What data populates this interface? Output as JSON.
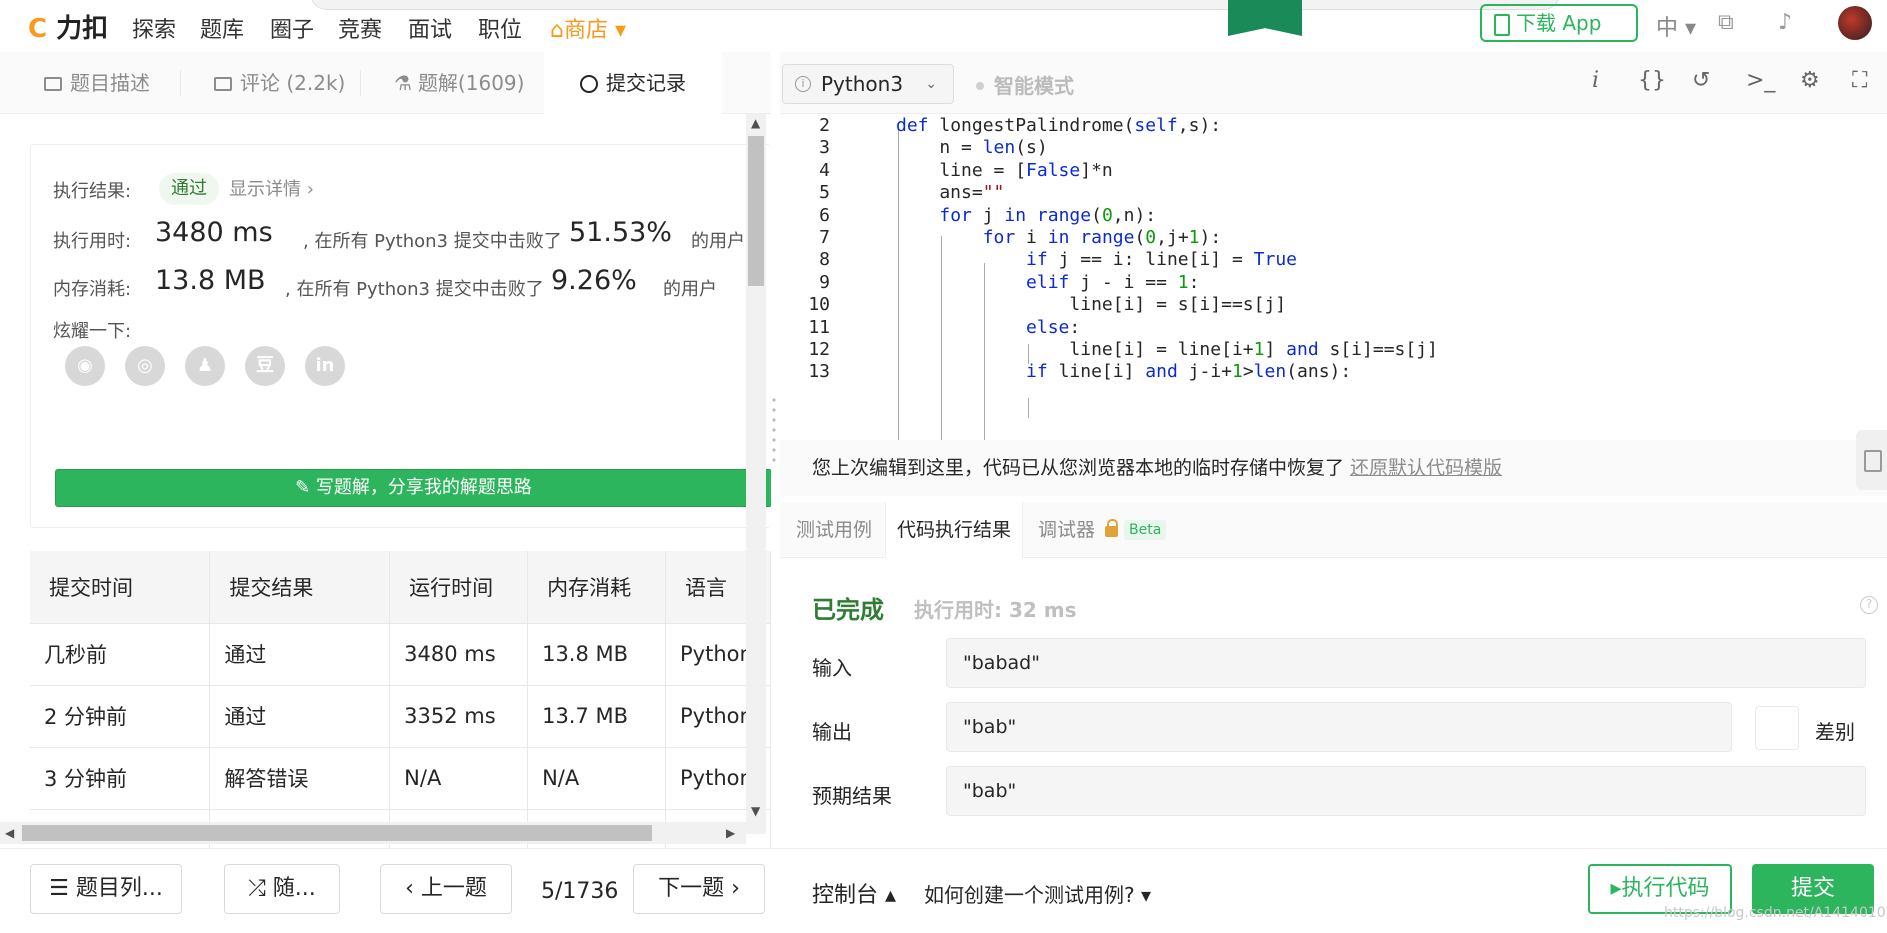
{
  "topnav": {
    "logo": "力扣",
    "items": [
      "探索",
      "题库",
      "圈子",
      "竞赛",
      "面试",
      "职位"
    ],
    "shop": "商店",
    "download_app": "下载 App",
    "lang": "中"
  },
  "left_tabs": [
    {
      "label": "题目描述"
    },
    {
      "label": "评论 (2.2k)"
    },
    {
      "label": "题解(1609)"
    },
    {
      "label": "提交记录"
    }
  ],
  "result": {
    "exec_result_label": "执行结果:",
    "status": "通过",
    "details_link": "显示详情 ›",
    "time_label": "执行用时:",
    "time_value": "3480 ms",
    "time_mid": ", 在所有 Python3 提交中击败了",
    "time_pct": "51.53%",
    "mem_label": "内存消耗:",
    "mem_value": "13.8 MB",
    "mem_mid": ", 在所有 Python3 提交中击败了",
    "mem_pct": "9.26%",
    "users_suffix": "的用户",
    "share_label": "炫耀一下:",
    "share_icons": [
      {
        "name": "wechat-icon",
        "glyph": "◉"
      },
      {
        "name": "weibo-icon",
        "glyph": "◎"
      },
      {
        "name": "qq-icon",
        "glyph": "♟"
      },
      {
        "name": "douban-icon",
        "glyph": "豆"
      },
      {
        "name": "linkedin-icon",
        "glyph": "in"
      }
    ],
    "write_solution": "✎ 写题解，分享我的解题思路"
  },
  "submissions": {
    "headers": [
      "提交时间",
      "提交结果",
      "运行时间",
      "内存消耗",
      "语言"
    ],
    "rows": [
      {
        "time": "几秒前",
        "result": "通过",
        "ok": true,
        "runtime": "3480 ms",
        "memory": "13.8 MB",
        "lang": "Python"
      },
      {
        "time": "2 分钟前",
        "result": "通过",
        "ok": true,
        "runtime": "3352 ms",
        "memory": "13.7 MB",
        "lang": "Python"
      },
      {
        "time": "3 分钟前",
        "result": "解答错误",
        "ok": false,
        "runtime": "N/A",
        "memory": "N/A",
        "lang": "Python"
      }
    ]
  },
  "editor": {
    "language": "Python3",
    "smart_mode": "智能模式",
    "tool_icons": [
      "info-icon",
      "braces-icon",
      "reset-icon",
      "terminal-icon",
      "settings-icon",
      "fullscreen-icon"
    ],
    "lines": [
      {
        "n": "2",
        "html": "<span class=\"kw\">def</span> longestPalindrome(<span class=\"kw\">self</span>,s):"
      },
      {
        "n": "3",
        "html": "    n = <span class=\"kw\">len</span>(s)"
      },
      {
        "n": "4",
        "html": "    line = [<span class=\"kw\">False</span>]*n"
      },
      {
        "n": "5",
        "html": "    ans=<span class=\"str\">\"\"</span>"
      },
      {
        "n": "6",
        "html": "    <span class=\"kw\">for</span> j <span class=\"kw\">in</span> <span class=\"kw\">range</span>(<span class=\"num\">0</span>,n):"
      },
      {
        "n": "7",
        "html": "        <span class=\"kw\">for</span> i <span class=\"kw\">in</span> <span class=\"kw\">range</span>(<span class=\"num\">0</span>,j+<span class=\"num\">1</span>):"
      },
      {
        "n": "8",
        "html": "            <span class=\"kw\">if</span> j == i: line[i] = <span class=\"kw\">True</span>"
      },
      {
        "n": "9",
        "html": "            <span class=\"kw\">elif</span> j - i == <span class=\"num\">1</span>:"
      },
      {
        "n": "10",
        "html": "                line[i] = s[i]==s[j]"
      },
      {
        "n": "11",
        "html": "            <span class=\"kw\">else</span>:"
      },
      {
        "n": "12",
        "html": "                line[i] = line[i+<span class=\"num\">1</span>] <span class=\"kw\">and</span> s[i]==s[j]"
      },
      {
        "n": "13",
        "html": "            <span class=\"kw\">if</span> line[i] <span class=\"kw\">and</span> j-i+<span class=\"num\">1</span>><span class=\"kw\">len</span>(ans):"
      }
    ]
  },
  "restore": {
    "text": "您上次编辑到这里，代码已从您浏览器本地的临时存储中恢复了",
    "link": "还原默认代码模版"
  },
  "console_tabs": {
    "testcase": "测试用例",
    "result": "代码执行结果",
    "debugger": "调试器",
    "beta": "Beta"
  },
  "exec": {
    "status": "已完成",
    "time": "执行用时: 32 ms",
    "input_label": "输入",
    "input_value": "\"babad\"",
    "output_label": "输出",
    "output_value": "\"bab\"",
    "diff_label": "差别",
    "expected_label": "预期结果",
    "expected_value": "\"bab\""
  },
  "bottom": {
    "problem_list": "☰ 题目列...",
    "random": "⤮ 随...",
    "prev": "‹ 上一题",
    "page": "5/1736",
    "next": "下一题 ›",
    "console": "控制台 ▴",
    "howto": "如何创建一个测试用例? ▾",
    "run": "▸执行代码",
    "submit": "提交",
    "watermark": "https://blog.csdn.net/A1414010"
  }
}
